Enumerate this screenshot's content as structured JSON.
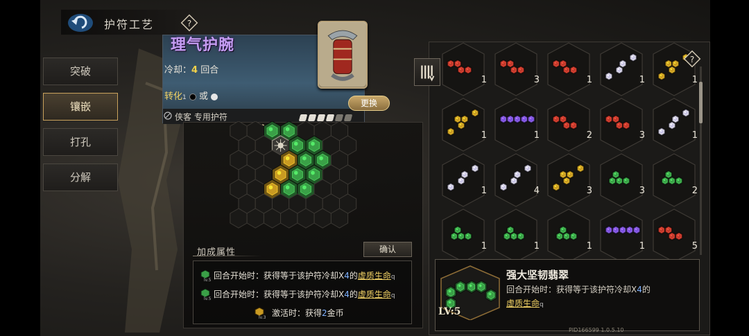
{
  "header": {
    "title": "护符工艺"
  },
  "menu": [
    {
      "label": "突破",
      "active": false
    },
    {
      "label": "镶嵌",
      "active": true
    },
    {
      "label": "打孔",
      "active": false
    },
    {
      "label": "分解",
      "active": false
    }
  ],
  "item": {
    "name": "理气护腕",
    "cooldown_label": "冷却：",
    "cooldown_value": "4",
    "cooldown_unit": "回合",
    "convert_label": "转化",
    "convert_num": "1",
    "convert_or": "或",
    "change_button": "更换",
    "exclusive": "侠客 专用护符"
  },
  "stars": {
    "filled": 4,
    "total": 6
  },
  "attributes": {
    "title": "加成属性",
    "confirm_button": "确认",
    "rows": [
      {
        "prefix": "回合开始时：获得等于该护符冷却X",
        "num": "4",
        "mid": "的",
        "link": "虚质生命",
        "lv": "lv.5"
      },
      {
        "prefix": "回合开始时：获得等于该护符冷却X",
        "num": "4",
        "mid": "的",
        "link": "虚质生命",
        "lv": "lv.5"
      },
      {
        "prefix": "激活时：获得",
        "num": "2",
        "mid": "",
        "link": "金币",
        "lv": "lv.3"
      }
    ]
  },
  "inventory": {
    "rows": [
      [
        {
          "color": "red",
          "count": "1"
        },
        {
          "color": "red",
          "count": "3"
        },
        {
          "color": "red",
          "count": "1"
        },
        {
          "color": "white",
          "count": "1"
        },
        {
          "color": "gold",
          "count": "1"
        }
      ],
      [
        {
          "color": "gold",
          "count": "1"
        },
        {
          "color": "purple",
          "count": "1"
        },
        {
          "color": "red",
          "count": "2"
        },
        {
          "color": "red",
          "count": "3"
        },
        {
          "color": "white",
          "count": "1"
        }
      ],
      [
        {
          "color": "white",
          "count": "1"
        },
        {
          "color": "white",
          "count": "4"
        },
        {
          "color": "gold",
          "count": "3"
        },
        {
          "color": "green",
          "count": "3"
        },
        {
          "color": "green",
          "count": "2"
        }
      ],
      [
        {
          "color": "green",
          "count": "1"
        },
        {
          "color": "green",
          "count": "1"
        },
        {
          "color": "green",
          "count": "1"
        },
        {
          "color": "purple",
          "count": "1"
        },
        {
          "color": "red",
          "count": "5"
        }
      ]
    ]
  },
  "detail": {
    "name": "强大坚韧翡翠",
    "desc_prefix": "回合开始时：获得等于该护符冷却X",
    "desc_num": "4",
    "desc_mid": "的",
    "desc_link": "虚质生命",
    "level": "LV:5"
  },
  "footer": {
    "pid": "PID166599 1.0.5.10"
  },
  "colors": {
    "green": "#3aa047",
    "gold": "#c99a22",
    "red": "#c0392b",
    "white": "#c9c4e6",
    "purple": "#7a52e0",
    "accent": "#f2d264",
    "highlight": "#7fb2ff"
  }
}
